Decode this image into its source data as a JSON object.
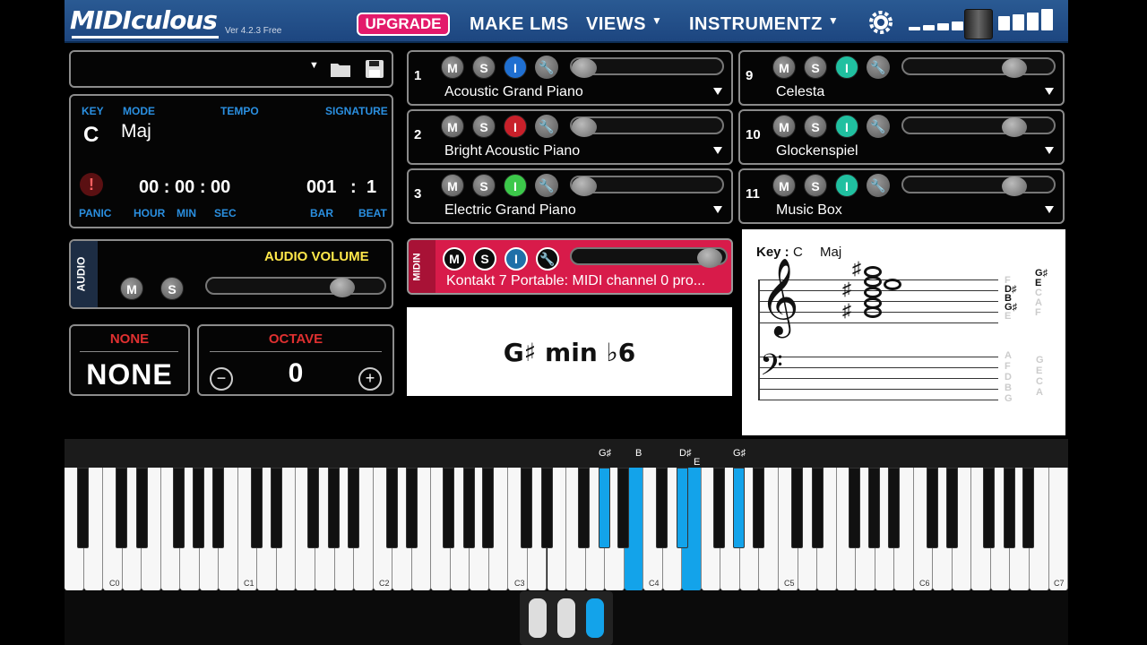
{
  "header": {
    "logo": "MIDIculous",
    "version": "Ver 4.2.3 Free",
    "upgrade": "UPGRADE",
    "menu": [
      "MAKE LMS",
      "VIEWS",
      "INSTRUMENTZ"
    ]
  },
  "project": {},
  "transport": {
    "key_label": "KEY",
    "mode_label": "MODE",
    "tempo_label": "TEMPO",
    "signature_label": "SIGNATURE",
    "key": "C",
    "mode": "Maj",
    "time": "00 : 00 : 00",
    "bar": "001",
    "sep": ":",
    "beat": "1",
    "panic_label": "PANIC",
    "hour_label": "HOUR",
    "min_label": "MIN",
    "sec_label": "SEC",
    "bar_label": "BAR",
    "beat_label": "BEAT"
  },
  "audio": {
    "tab": "AUDIO",
    "title": "AUDIO VOLUME",
    "m": "M",
    "s": "S",
    "volume": 0.78
  },
  "none_box": {
    "title": "NONE",
    "value": "NONE"
  },
  "octave_box": {
    "title": "OCTAVE",
    "value": "0",
    "minus": "−",
    "plus": "+"
  },
  "tracks": [
    {
      "num": "1",
      "name": "Acoustic Grand Piano",
      "i_color": "#1f6fd1"
    },
    {
      "num": "2",
      "name": "Bright Acoustic Piano",
      "i_color": "#c8202a"
    },
    {
      "num": "3",
      "name": "Electric Grand Piano",
      "i_color": "#3cc84a"
    },
    {
      "num": "9",
      "name": "Celesta",
      "i_color": "#20c0a0"
    },
    {
      "num": "10",
      "name": "Glockenspiel",
      "i_color": "#20c0a0"
    },
    {
      "num": "11",
      "name": "Music Box",
      "i_color": "#20c0a0"
    }
  ],
  "track_buttons": {
    "m": "M",
    "s": "S",
    "i": "I"
  },
  "midin": {
    "tab": "MIDIN",
    "device": "Kontakt 7 Portable: MIDI channel 0 pro...",
    "m": "M",
    "s": "S",
    "i": "I"
  },
  "chord": {
    "name": "G♯ min ♭6"
  },
  "staff": {
    "key_text": "Key :",
    "key": "C",
    "mode": "Maj",
    "treble_notes": [
      "D♯",
      "B",
      "G♯"
    ],
    "treble_letters": [
      "G♯",
      "E",
      "C",
      "A",
      "F"
    ],
    "treble_notes_grey": [
      "F",
      "E"
    ],
    "bass_letters_left": [
      "A",
      "F",
      "D",
      "B",
      "G"
    ],
    "bass_letters_right": [
      "G",
      "E",
      "C",
      "A"
    ]
  },
  "piano": {
    "note_labels": [
      "G♯",
      "B",
      "D♯",
      "E",
      "G♯"
    ],
    "octave_labels": [
      "C0",
      "C1",
      "C2",
      "C3",
      "C4",
      "C5",
      "C6",
      "C7"
    ]
  },
  "colors": {
    "accent": "#13a3ea",
    "topbar": "#1d4680",
    "upgrade": "#e31a6b",
    "audio_title": "#ffe84a",
    "midin": "#d81b4a"
  }
}
